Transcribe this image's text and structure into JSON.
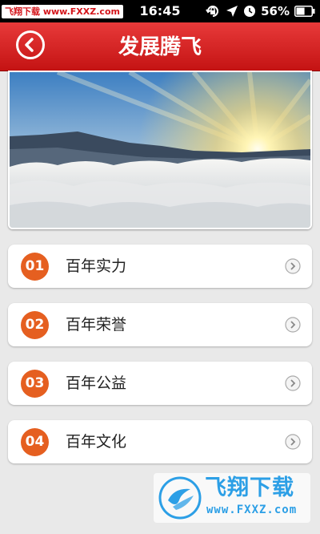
{
  "status_bar": {
    "watermark": "飞翔下载 www.FXXZ.com",
    "time": "16:45",
    "battery_percent": "56%",
    "battery_level": 0.56
  },
  "header": {
    "title": "发展腾飞"
  },
  "menu": {
    "items": [
      {
        "number": "01",
        "label": "百年实力"
      },
      {
        "number": "02",
        "label": "百年荣誉"
      },
      {
        "number": "03",
        "label": "百年公益"
      },
      {
        "number": "04",
        "label": "百年文化"
      }
    ]
  },
  "watermark": {
    "brand_text": "飞翔下载",
    "url": "www.FXXZ.com"
  },
  "colors": {
    "header_red": "#d42121",
    "number_badge": "#e55f20",
    "watermark_blue": "#2c9fe6"
  }
}
